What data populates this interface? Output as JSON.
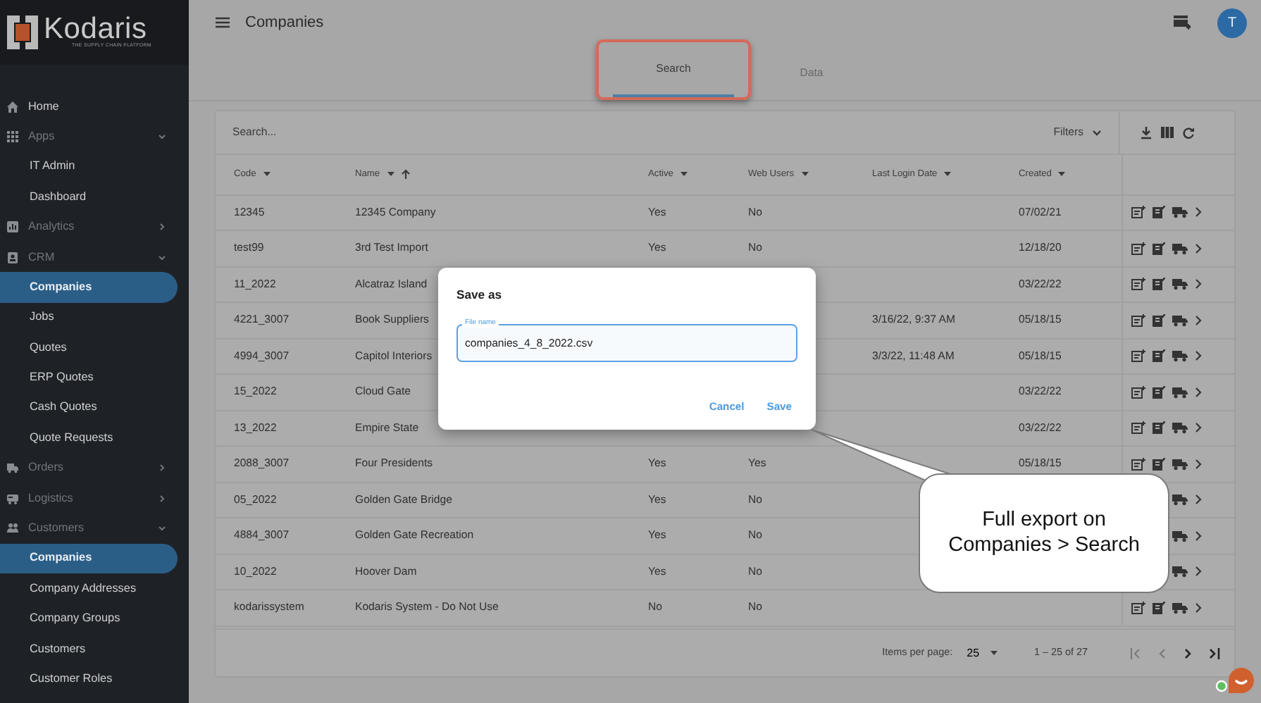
{
  "sidebar": {
    "logo": {
      "name": "Kodaris",
      "tagline": "THE SUPPLY CHAIN PLATFORM"
    },
    "items": [
      {
        "kind": "link",
        "label": "Home"
      },
      {
        "kind": "group",
        "label": "Apps",
        "expanded": true,
        "children": [
          {
            "label": "IT Admin",
            "selected": false
          },
          {
            "label": "Dashboard",
            "selected": false
          }
        ]
      },
      {
        "kind": "group",
        "label": "Analytics",
        "expanded": false
      },
      {
        "kind": "group",
        "label": "CRM",
        "expanded": true,
        "children": [
          {
            "label": "Companies",
            "selected": true
          },
          {
            "label": "Jobs",
            "selected": false
          },
          {
            "label": "Quotes",
            "selected": false
          },
          {
            "label": "ERP Quotes",
            "selected": false
          },
          {
            "label": "Cash Quotes",
            "selected": false
          },
          {
            "label": "Quote Requests",
            "selected": false
          }
        ]
      },
      {
        "kind": "group",
        "label": "Orders",
        "expanded": false
      },
      {
        "kind": "group",
        "label": "Logistics",
        "expanded": false
      },
      {
        "kind": "group",
        "label": "Customers",
        "expanded": true,
        "children": [
          {
            "label": "Companies",
            "selected": true
          },
          {
            "label": "Company Addresses",
            "selected": false
          },
          {
            "label": "Company Groups",
            "selected": false
          },
          {
            "label": "Customers",
            "selected": false
          },
          {
            "label": "Customer Roles",
            "selected": false
          }
        ]
      }
    ]
  },
  "header": {
    "title": "Companies",
    "avatar": "T"
  },
  "tabs": [
    {
      "label": "Search",
      "selected": true,
      "highlighted": true
    },
    {
      "label": "Data",
      "selected": false,
      "highlighted": false
    }
  ],
  "toolbar": {
    "search_placeholder": "Search...",
    "filters": "Filters"
  },
  "table": {
    "columns": [
      {
        "label": "Code",
        "sorted": false
      },
      {
        "label": "Name",
        "sorted": true
      },
      {
        "label": "Active",
        "sorted": false
      },
      {
        "label": "Web Users",
        "sorted": false
      },
      {
        "label": "Last Login Date",
        "sorted": false
      },
      {
        "label": "Created",
        "sorted": false
      }
    ],
    "rows": [
      {
        "code": "12345",
        "name": "12345 Company",
        "active": "Yes",
        "web_users": "No",
        "created": "07/02/21"
      },
      {
        "code": "test99",
        "name": "3rd Test Import",
        "active": "Yes",
        "web_users": "No",
        "created": "12/18/20"
      },
      {
        "code": "11_2022",
        "name": "Alcatraz Island",
        "created": "03/22/22"
      },
      {
        "code": "4221_3007",
        "name": "Book Suppliers",
        "last_login": "3/16/22, 9:37 AM",
        "created": "05/18/15"
      },
      {
        "code": "4994_3007",
        "name": "Capitol Interiors",
        "last_login": "3/3/22, 11:48 AM",
        "created": "05/18/15"
      },
      {
        "code": "15_2022",
        "name": "Cloud Gate",
        "created": "03/22/22"
      },
      {
        "code": "13_2022",
        "name": "Empire State",
        "created": "03/22/22"
      },
      {
        "code": "2088_3007",
        "name": "Four Presidents",
        "active": "Yes",
        "web_users": "Yes",
        "created": "05/18/15"
      },
      {
        "code": "05_2022",
        "name": "Golden Gate Bridge",
        "active": "Yes",
        "web_users": "No"
      },
      {
        "code": "4884_3007",
        "name": "Golden Gate Recreation",
        "active": "Yes",
        "web_users": "No"
      },
      {
        "code": "10_2022",
        "name": "Hoover Dam",
        "active": "Yes",
        "web_users": "No"
      },
      {
        "code": "kodarissystem",
        "name": "Kodaris System - Do Not Use",
        "active": "No",
        "web_users": "No"
      }
    ]
  },
  "paginator": {
    "label": "Items per page:",
    "page_size": "25",
    "range": "1 – 25 of 27"
  },
  "dialog": {
    "title": "Save as",
    "field_label": "File name",
    "value": "companies_4_8_2022.csv",
    "buttons": [
      "Cancel",
      "Save"
    ]
  },
  "callout": {
    "text": "Full export on Companies > Search"
  }
}
